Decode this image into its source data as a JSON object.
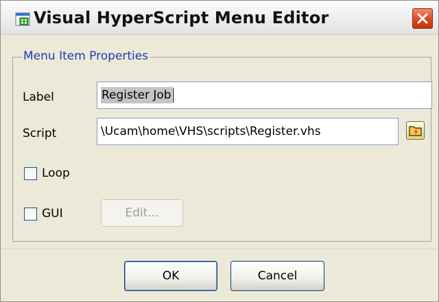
{
  "window": {
    "title": "Visual HyperScript Menu Editor",
    "app_icon": "hyperscript-app-icon",
    "close_icon": "close-icon"
  },
  "group": {
    "legend": "Menu Item Properties"
  },
  "form": {
    "label_caption": "Label",
    "label_value": "Register Job",
    "script_caption": "Script",
    "script_value": "\\Ucam\\home\\VHS\\scripts\\Register.vhs",
    "browse_icon": "folder-browse-icon",
    "loop_caption": "Loop",
    "loop_checked": false,
    "gui_caption": "GUI",
    "gui_checked": false,
    "edit_label": "Edit..."
  },
  "buttons": {
    "ok_label": "OK",
    "cancel_label": "Cancel"
  },
  "colors": {
    "legend": "#1e3ea8",
    "close_button": "#d9491f",
    "window_bg": "#ece9d8"
  }
}
